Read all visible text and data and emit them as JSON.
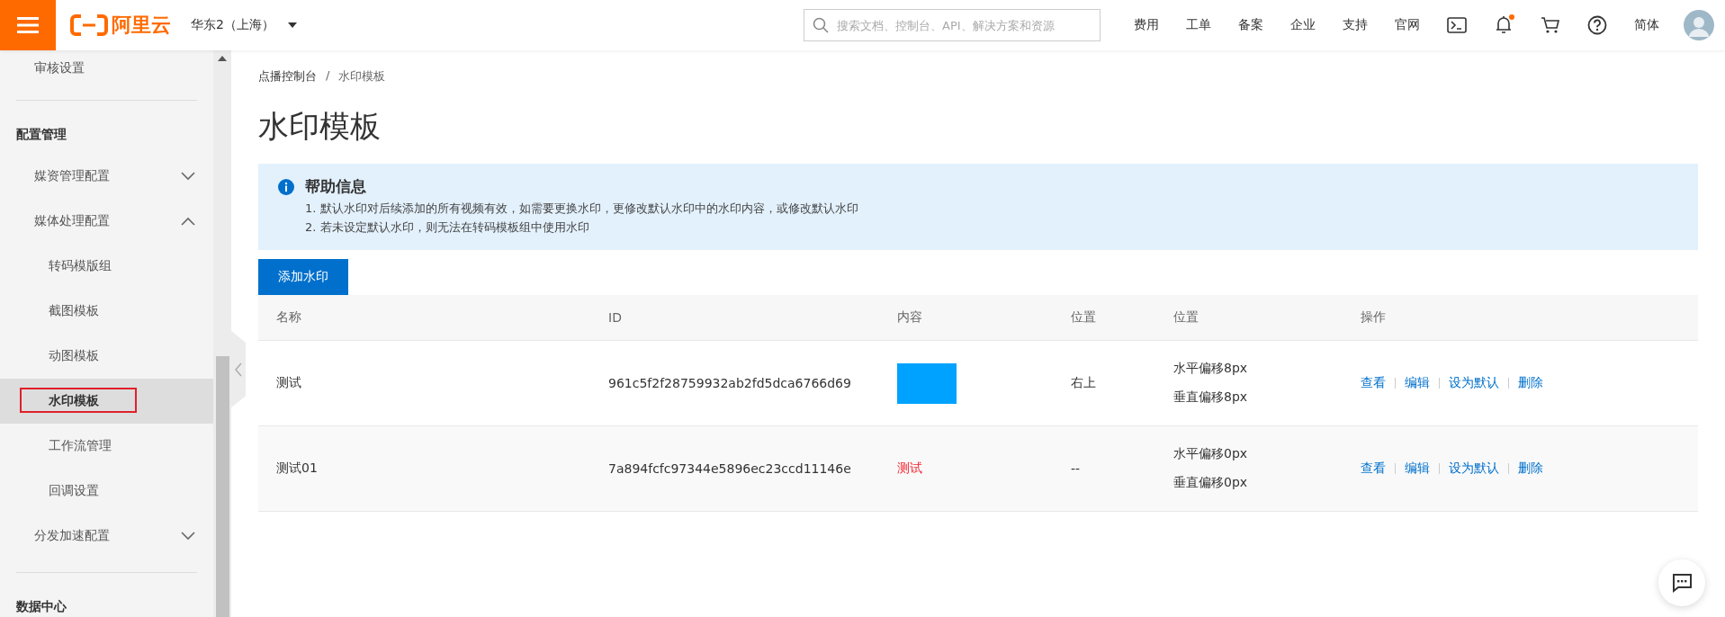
{
  "header": {
    "logo_text": "阿里云",
    "region": "华东2（上海）",
    "search": {
      "placeholder": "搜索文档、控制台、API、解决方案和资源"
    },
    "nav_links": [
      "费用",
      "工单",
      "备案",
      "企业",
      "支持",
      "官网"
    ],
    "notification_dot": true,
    "language": "简体"
  },
  "sidebar": {
    "sections": [
      {
        "items": [
          {
            "label": "审核设置"
          }
        ]
      },
      {
        "title": "配置管理",
        "items": [
          {
            "label": "媒资管理配置",
            "expanded": false
          },
          {
            "label": "媒体处理配置",
            "expanded": true,
            "children": [
              {
                "label": "转码模版组",
                "selected": false
              },
              {
                "label": "截图模板",
                "selected": false
              },
              {
                "label": "动图模板",
                "selected": false
              },
              {
                "label": "水印模板",
                "selected": true
              },
              {
                "label": "工作流管理",
                "selected": false
              },
              {
                "label": "回调设置",
                "selected": false
              }
            ]
          },
          {
            "label": "分发加速配置",
            "expanded": false
          }
        ]
      },
      {
        "title": "数据中心"
      }
    ]
  },
  "breadcrumb": [
    "点播控制台",
    "水印模板"
  ],
  "breadcrumb_separator": "/",
  "page_title": "水印模板",
  "help": {
    "title": "帮助信息",
    "lines": [
      "1. 默认水印对后续添加的所有视频有效，如需要更换水印，更修改默认水印中的水印内容，或修改默认水印",
      "2. 若未设定默认水印，则无法在转码模板组中使用水印"
    ]
  },
  "add_button": "添加水印",
  "table": {
    "columns": [
      "名称",
      "ID",
      "内容",
      "位置",
      "位置",
      "操作"
    ],
    "rows": [
      {
        "name": "测试",
        "id": "961c5f2f28759932ab2fd5dca6766d69",
        "content": {
          "kind": "image"
        },
        "position": "右上",
        "offsets": [
          "水平偏移8px",
          "垂直偏移8px"
        ],
        "actions": [
          "查看",
          "编辑",
          "设为默认",
          "删除"
        ]
      },
      {
        "name": "测试01",
        "id": "7a894fcfc97344e5896ec23ccd11146e",
        "content": {
          "kind": "text",
          "text": "测试"
        },
        "position": "--",
        "offsets": [
          "水平偏移0px",
          "垂直偏移0px"
        ],
        "actions": [
          "查看",
          "编辑",
          "设为默认",
          "删除"
        ]
      }
    ]
  }
}
